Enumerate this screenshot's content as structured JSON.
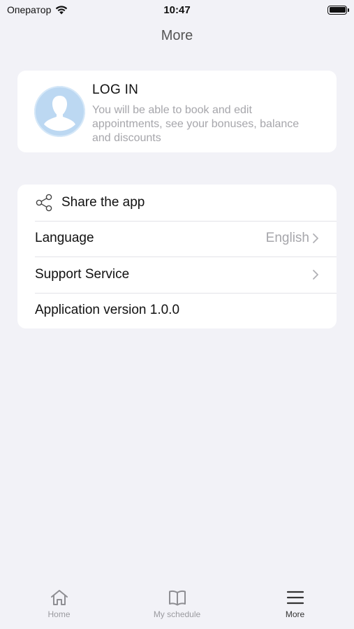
{
  "status_bar": {
    "carrier": "Оператор",
    "time": "10:47"
  },
  "nav": {
    "title": "More"
  },
  "login": {
    "title": "LOG IN",
    "description": "You will be able to book and edit appointments, see your bonuses, balance and discounts"
  },
  "settings": {
    "share_label": "Share the app",
    "language_label": "Language",
    "language_value": "English",
    "support_label": "Support Service",
    "version_label": "Application version 1.0.0"
  },
  "tabs": [
    {
      "label": "Home",
      "icon": "home-icon",
      "active": false
    },
    {
      "label": "My schedule",
      "icon": "book-icon",
      "active": false
    },
    {
      "label": "More",
      "icon": "menu-icon",
      "active": true
    }
  ],
  "colors": {
    "background": "#f2f2f7",
    "avatar": "#b9d7f2",
    "secondary_text": "#a6a6ab"
  }
}
